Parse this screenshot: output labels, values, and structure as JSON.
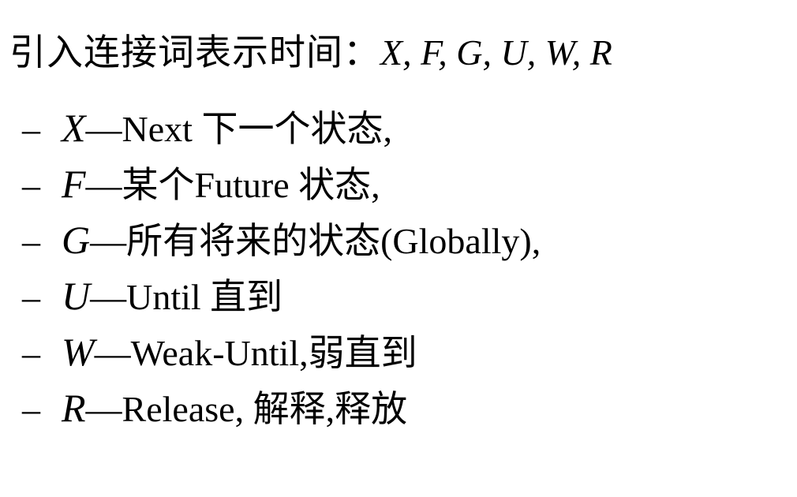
{
  "heading": {
    "prefix": "引入连接词表示时间：",
    "operators": "X, F, G, U, W, R"
  },
  "items": [
    {
      "bullet": "–",
      "symbol": "X",
      "separator": "—",
      "description": "Next 下一个状态,"
    },
    {
      "bullet": "–",
      "symbol": "F",
      "separator": "—",
      "description": "某个Future 状态,"
    },
    {
      "bullet": "–",
      "symbol": "G",
      "separator": "—",
      "description": "所有将来的状态(Globally),"
    },
    {
      "bullet": "–",
      "symbol": "U",
      "separator": "—",
      "description": "Until 直到"
    },
    {
      "bullet": "–",
      "symbol": "W",
      "separator": "—",
      "description": "Weak-Until,弱直到"
    },
    {
      "bullet": "–",
      "symbol": "R",
      "separator": "—",
      "description": "Release, 解释,释放"
    }
  ]
}
